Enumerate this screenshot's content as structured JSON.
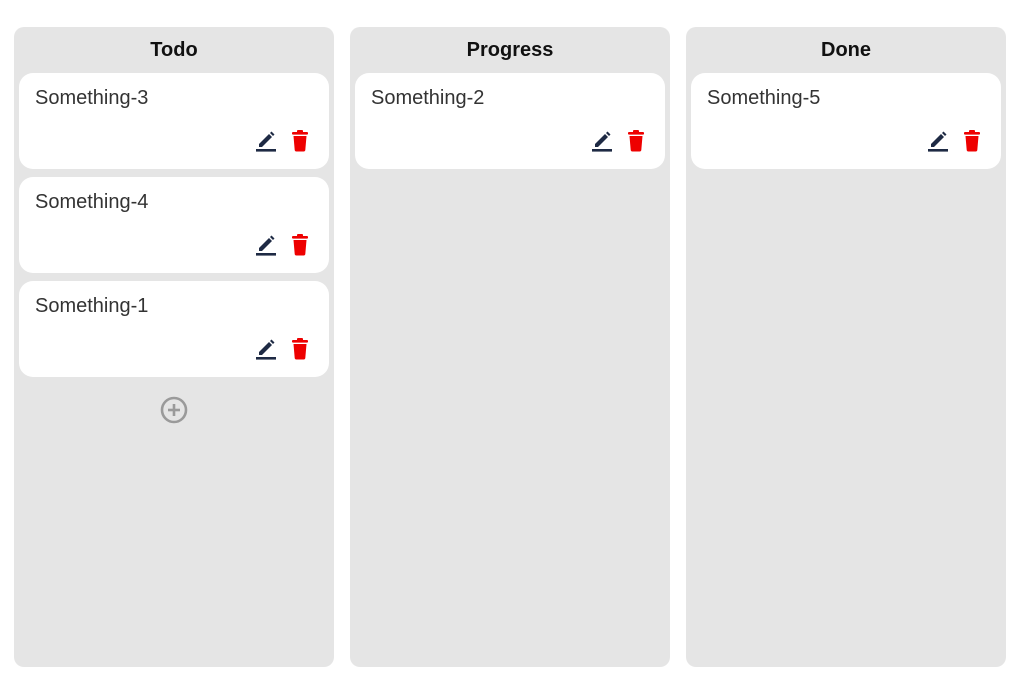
{
  "colors": {
    "column_bg": "#e5e5e5",
    "card_bg": "#ffffff",
    "edit_icon": "#1e2a44",
    "delete_icon": "#ee0000",
    "add_icon": "#9a9a9a"
  },
  "columns": [
    {
      "title": "Todo",
      "cards": [
        {
          "text": "Something-3"
        },
        {
          "text": "Something-4"
        },
        {
          "text": "Something-1"
        }
      ],
      "has_add_button": true
    },
    {
      "title": "Progress",
      "cards": [
        {
          "text": "Something-2"
        }
      ],
      "has_add_button": false
    },
    {
      "title": "Done",
      "cards": [
        {
          "text": "Something-5"
        }
      ],
      "has_add_button": false
    }
  ],
  "icons": {
    "edit": "pencil-icon",
    "delete": "trash-icon",
    "add": "plus-circle-icon"
  }
}
